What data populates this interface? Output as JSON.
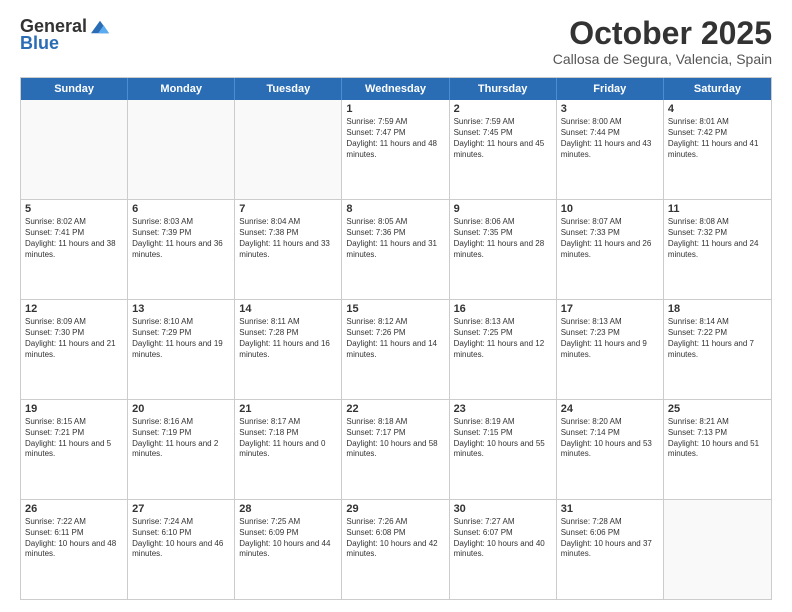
{
  "header": {
    "logo_general": "General",
    "logo_blue": "Blue",
    "month_title": "October 2025",
    "location": "Callosa de Segura, Valencia, Spain"
  },
  "days_of_week": [
    "Sunday",
    "Monday",
    "Tuesday",
    "Wednesday",
    "Thursday",
    "Friday",
    "Saturday"
  ],
  "weeks": [
    [
      {
        "day": "",
        "text": ""
      },
      {
        "day": "",
        "text": ""
      },
      {
        "day": "",
        "text": ""
      },
      {
        "day": "1",
        "text": "Sunrise: 7:59 AM\nSunset: 7:47 PM\nDaylight: 11 hours and 48 minutes."
      },
      {
        "day": "2",
        "text": "Sunrise: 7:59 AM\nSunset: 7:45 PM\nDaylight: 11 hours and 45 minutes."
      },
      {
        "day": "3",
        "text": "Sunrise: 8:00 AM\nSunset: 7:44 PM\nDaylight: 11 hours and 43 minutes."
      },
      {
        "day": "4",
        "text": "Sunrise: 8:01 AM\nSunset: 7:42 PM\nDaylight: 11 hours and 41 minutes."
      }
    ],
    [
      {
        "day": "5",
        "text": "Sunrise: 8:02 AM\nSunset: 7:41 PM\nDaylight: 11 hours and 38 minutes."
      },
      {
        "day": "6",
        "text": "Sunrise: 8:03 AM\nSunset: 7:39 PM\nDaylight: 11 hours and 36 minutes."
      },
      {
        "day": "7",
        "text": "Sunrise: 8:04 AM\nSunset: 7:38 PM\nDaylight: 11 hours and 33 minutes."
      },
      {
        "day": "8",
        "text": "Sunrise: 8:05 AM\nSunset: 7:36 PM\nDaylight: 11 hours and 31 minutes."
      },
      {
        "day": "9",
        "text": "Sunrise: 8:06 AM\nSunset: 7:35 PM\nDaylight: 11 hours and 28 minutes."
      },
      {
        "day": "10",
        "text": "Sunrise: 8:07 AM\nSunset: 7:33 PM\nDaylight: 11 hours and 26 minutes."
      },
      {
        "day": "11",
        "text": "Sunrise: 8:08 AM\nSunset: 7:32 PM\nDaylight: 11 hours and 24 minutes."
      }
    ],
    [
      {
        "day": "12",
        "text": "Sunrise: 8:09 AM\nSunset: 7:30 PM\nDaylight: 11 hours and 21 minutes."
      },
      {
        "day": "13",
        "text": "Sunrise: 8:10 AM\nSunset: 7:29 PM\nDaylight: 11 hours and 19 minutes."
      },
      {
        "day": "14",
        "text": "Sunrise: 8:11 AM\nSunset: 7:28 PM\nDaylight: 11 hours and 16 minutes."
      },
      {
        "day": "15",
        "text": "Sunrise: 8:12 AM\nSunset: 7:26 PM\nDaylight: 11 hours and 14 minutes."
      },
      {
        "day": "16",
        "text": "Sunrise: 8:13 AM\nSunset: 7:25 PM\nDaylight: 11 hours and 12 minutes."
      },
      {
        "day": "17",
        "text": "Sunrise: 8:13 AM\nSunset: 7:23 PM\nDaylight: 11 hours and 9 minutes."
      },
      {
        "day": "18",
        "text": "Sunrise: 8:14 AM\nSunset: 7:22 PM\nDaylight: 11 hours and 7 minutes."
      }
    ],
    [
      {
        "day": "19",
        "text": "Sunrise: 8:15 AM\nSunset: 7:21 PM\nDaylight: 11 hours and 5 minutes."
      },
      {
        "day": "20",
        "text": "Sunrise: 8:16 AM\nSunset: 7:19 PM\nDaylight: 11 hours and 2 minutes."
      },
      {
        "day": "21",
        "text": "Sunrise: 8:17 AM\nSunset: 7:18 PM\nDaylight: 11 hours and 0 minutes."
      },
      {
        "day": "22",
        "text": "Sunrise: 8:18 AM\nSunset: 7:17 PM\nDaylight: 10 hours and 58 minutes."
      },
      {
        "day": "23",
        "text": "Sunrise: 8:19 AM\nSunset: 7:15 PM\nDaylight: 10 hours and 55 minutes."
      },
      {
        "day": "24",
        "text": "Sunrise: 8:20 AM\nSunset: 7:14 PM\nDaylight: 10 hours and 53 minutes."
      },
      {
        "day": "25",
        "text": "Sunrise: 8:21 AM\nSunset: 7:13 PM\nDaylight: 10 hours and 51 minutes."
      }
    ],
    [
      {
        "day": "26",
        "text": "Sunrise: 7:22 AM\nSunset: 6:11 PM\nDaylight: 10 hours and 48 minutes."
      },
      {
        "day": "27",
        "text": "Sunrise: 7:24 AM\nSunset: 6:10 PM\nDaylight: 10 hours and 46 minutes."
      },
      {
        "day": "28",
        "text": "Sunrise: 7:25 AM\nSunset: 6:09 PM\nDaylight: 10 hours and 44 minutes."
      },
      {
        "day": "29",
        "text": "Sunrise: 7:26 AM\nSunset: 6:08 PM\nDaylight: 10 hours and 42 minutes."
      },
      {
        "day": "30",
        "text": "Sunrise: 7:27 AM\nSunset: 6:07 PM\nDaylight: 10 hours and 40 minutes."
      },
      {
        "day": "31",
        "text": "Sunrise: 7:28 AM\nSunset: 6:06 PM\nDaylight: 10 hours and 37 minutes."
      },
      {
        "day": "",
        "text": ""
      }
    ]
  ]
}
